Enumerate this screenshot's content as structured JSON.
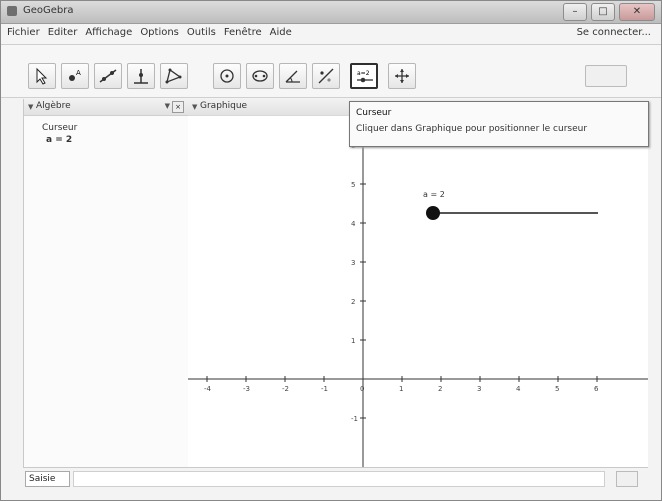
{
  "window": {
    "title": "GeoGebra"
  },
  "menu": {
    "items": [
      "Fichier",
      "Editer",
      "Affichage",
      "Options",
      "Outils",
      "Fenêtre",
      "Aide"
    ],
    "perspective": "Se connecter..."
  },
  "toolbar": {
    "tools": [
      {
        "name": "move-tool-icon"
      },
      {
        "name": "point-tool-icon"
      },
      {
        "name": "line-tool-icon"
      },
      {
        "name": "perpendicular-tool-icon"
      },
      {
        "name": "polygon-tool-icon"
      },
      {
        "name": "circle-tool-icon"
      },
      {
        "name": "conic-tool-icon"
      },
      {
        "name": "angle-tool-icon"
      },
      {
        "name": "reflect-tool-icon"
      },
      {
        "name": "slider-tool-icon",
        "selected": true
      },
      {
        "name": "move-graphics-tool-icon"
      }
    ]
  },
  "tooltip": {
    "title": "Curseur",
    "description": "Cliquer dans Graphique pour positionner le curseur"
  },
  "algebra": {
    "header": "Algèbre",
    "section": "Curseur",
    "entry": "a = 2"
  },
  "graphics": {
    "header": "Graphique",
    "slider_label": "a = 2",
    "slider_value": 2,
    "x_ticks": [
      "-4",
      "-3",
      "-2",
      "-1",
      "0",
      "1",
      "2",
      "3",
      "4",
      "5",
      "6"
    ],
    "y_ticks": [
      "6",
      "5",
      "4",
      "3",
      "2",
      "1",
      "-1"
    ]
  },
  "inputbar": {
    "label": "Saisie"
  },
  "colors": {
    "accent": "#2f2f2f",
    "slider": "#111111",
    "axis": "#333333"
  }
}
